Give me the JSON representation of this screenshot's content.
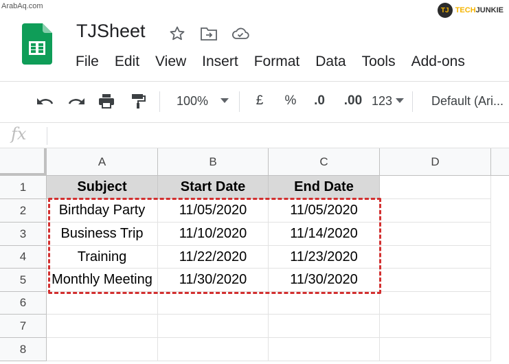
{
  "watermark": {
    "left_text": "ArabAq.com",
    "right_logo_text": "TJ",
    "right_brand_part1": "TECH",
    "right_brand_part2": "JUNKIE"
  },
  "app": {
    "title": "TJSheet",
    "icons": [
      "star-icon",
      "move-to-folder-icon",
      "cloud-saved-icon"
    ]
  },
  "menu": [
    "File",
    "Edit",
    "View",
    "Insert",
    "Format",
    "Data",
    "Tools",
    "Add-ons"
  ],
  "toolbar": {
    "zoom": "100%",
    "currency": "£",
    "percent": "%",
    "decrease_decimal": ".0",
    "increase_decimal": ".00",
    "more_formats": "123",
    "font": "Default (Ari..."
  },
  "formula_bar": {
    "fx_label": "fx",
    "value": ""
  },
  "columns": [
    "A",
    "B",
    "C",
    "D"
  ],
  "rows": [
    "1",
    "2",
    "3",
    "4",
    "5",
    "6",
    "7",
    "8"
  ],
  "table": {
    "headers": [
      "Subject",
      "Start Date",
      "End Date"
    ],
    "data": [
      [
        "Birthday Party",
        "11/05/2020",
        "11/05/2020"
      ],
      [
        "Business Trip",
        "11/10/2020",
        "11/14/2020"
      ],
      [
        "Training",
        "11/22/2020",
        "11/23/2020"
      ],
      [
        "Monthly Meeting",
        "11/30/2020",
        "11/30/2020"
      ]
    ]
  },
  "colors": {
    "header_fill": "#d9d9d9",
    "selection_dash": "#d32f2f",
    "sheets_green": "#0f9d58"
  }
}
